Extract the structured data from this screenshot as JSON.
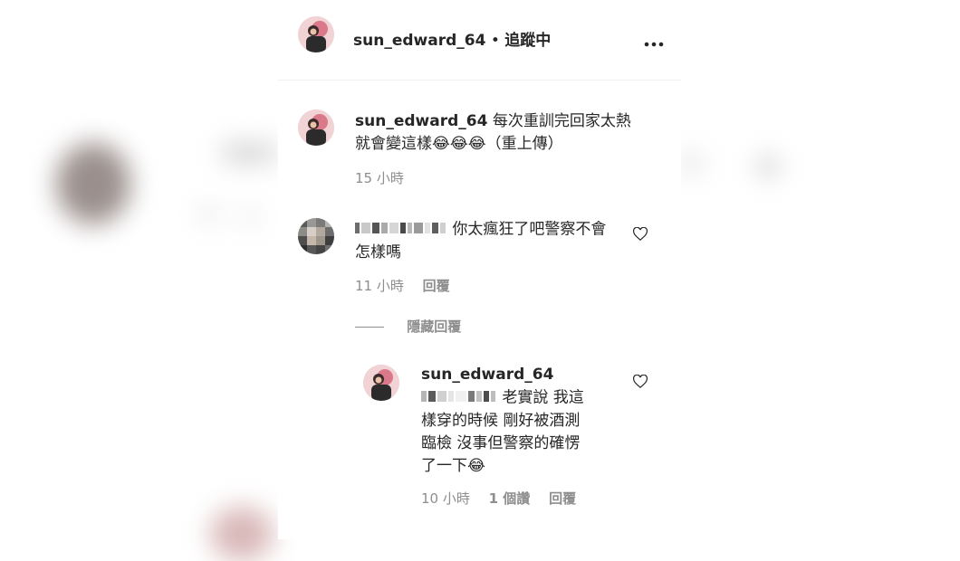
{
  "header": {
    "username": "sun_edward_64",
    "separator": "•",
    "follow_status": "追蹤中",
    "more_icon": "more-horizontal-icon"
  },
  "post": {
    "username": "sun_edward_64",
    "caption_line1": "每次重訓完回家太熱",
    "caption_line2": "就會變這樣😂😂😂（重上傳）",
    "time": "15 小時"
  },
  "comment1": {
    "text_line1": "你太瘋狂了吧警察不會",
    "text_line2": "怎樣嗎",
    "time": "11 小時",
    "reply_label": "回覆"
  },
  "replies_toggle": {
    "label": "隱藏回覆"
  },
  "reply1": {
    "username": "sun_edward_64",
    "text_line1": "老實說 我這",
    "text_line2": "樣穿的時候 剛好被酒測",
    "text_line3": "臨檢 沒事但警察的確愣",
    "text_line4": "了一下😂",
    "time": "10 小時",
    "likes": "1 個讚",
    "reply_label": "回覆"
  },
  "colors": {
    "text": "#262626",
    "secondary": "#8e8e8e",
    "divider": "#efefef"
  }
}
